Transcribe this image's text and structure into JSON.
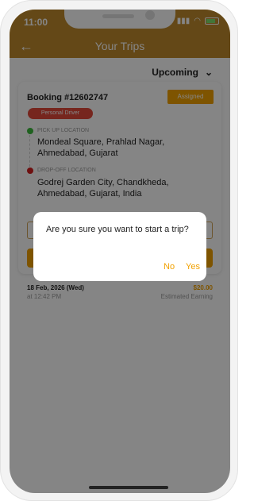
{
  "status_bar": {
    "time": "11:00",
    "location_icon": "location-arrow-icon",
    "signal_icon": "signal-bars-icon",
    "wifi_icon": "wifi-icon",
    "battery_icon": "battery-charging-icon"
  },
  "header": {
    "title": "Your Trips",
    "back_icon": "back-arrow-icon",
    "color": "#c08a2c"
  },
  "filter": {
    "selected": "Upcoming",
    "chevron_icon": "chevron-down-icon"
  },
  "trip": {
    "booking_label": "Booking #12602747",
    "status": "Assigned",
    "service_type": "Personal Driver",
    "pickup": {
      "label": "PICK UP LOCATION",
      "address": "Mondeal Square, Prahlad Nagar, Ahmedabad, Gujarat"
    },
    "dropoff": {
      "label": "DROP-OFF LOCATION",
      "address": "Godrej Garden City, Chandkheda, Ahmedabad, Gujarat, India"
    },
    "date": "18 Feb, 2026 (Wed)",
    "time": "at 12:42 PM",
    "amount": "$20.00",
    "amount_label": "Estimated Earning"
  },
  "dialog": {
    "message": "Are you sure you want to start a trip?",
    "no_label": "No",
    "yes_label": "Yes",
    "accent": "#f2a100"
  }
}
